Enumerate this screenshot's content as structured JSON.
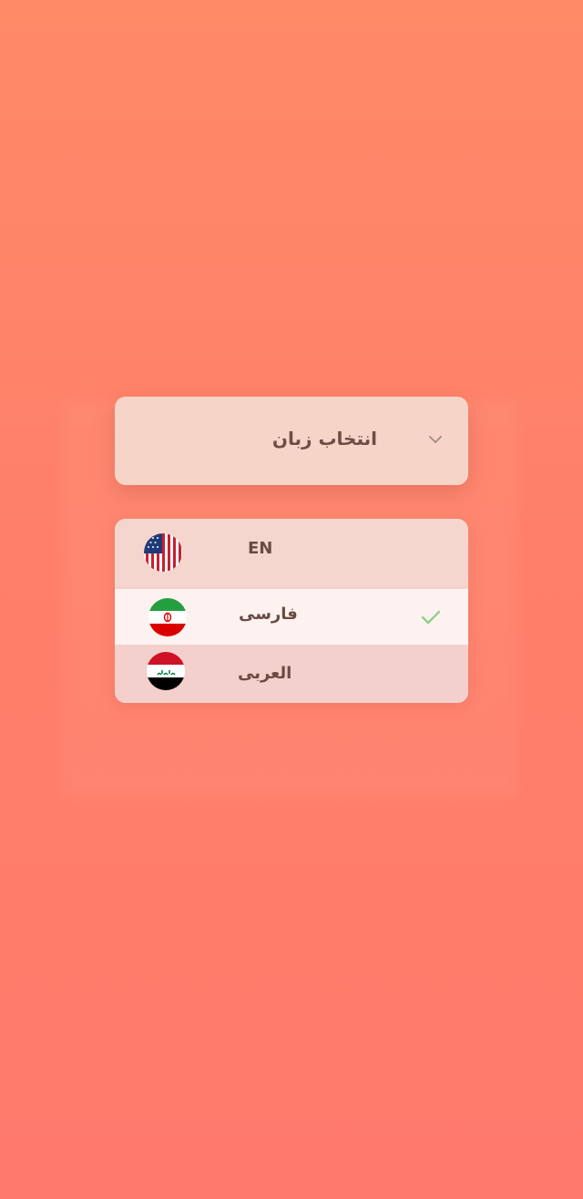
{
  "dropdown": {
    "title": "انتخاب زبان",
    "chevron_icon": "chevron-down-icon"
  },
  "languages": [
    {
      "label": "EN",
      "flag_icon": "usa-flag-icon",
      "selected": false
    },
    {
      "label": "فارسی",
      "flag_icon": "iran-flag-icon",
      "selected": true
    },
    {
      "label": "العربی",
      "flag_icon": "iraq-flag-icon",
      "selected": false
    }
  ],
  "colors": {
    "background_top": "#ff8a68",
    "background_bottom": "#ff7a6c",
    "card": "#f6d4c8",
    "selected_row": "#fdf2ef",
    "text": "#6b4a44",
    "check": "#8fd08a"
  }
}
